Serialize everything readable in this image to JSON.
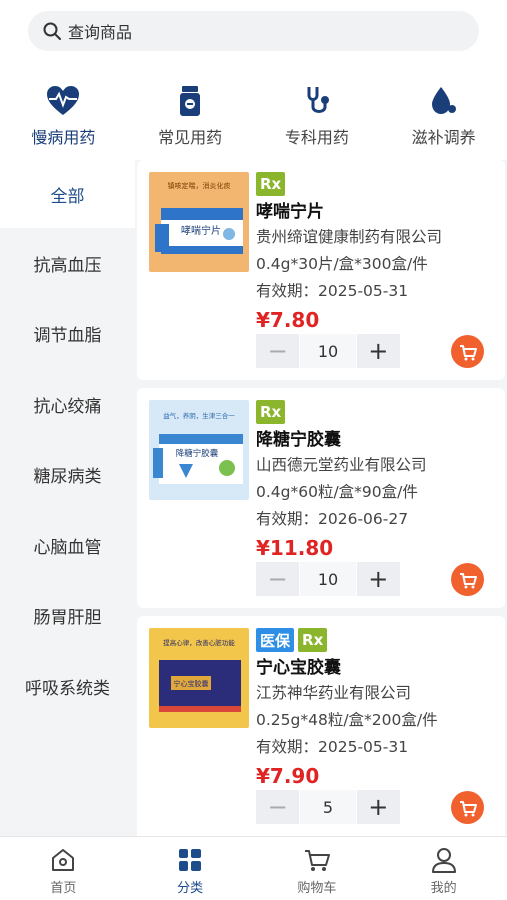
{
  "search": {
    "placeholder": "查询商品"
  },
  "top_categories": [
    {
      "label": "慢病用药",
      "icon": "heart-pulse-icon",
      "active": true
    },
    {
      "label": "常见用药",
      "icon": "pill-bottle-icon",
      "active": false
    },
    {
      "label": "专科用药",
      "icon": "stethoscope-icon",
      "active": false
    },
    {
      "label": "滋补调养",
      "icon": "drop-icon",
      "active": false
    }
  ],
  "sidebar": {
    "items": [
      {
        "label": "全部",
        "active": true
      },
      {
        "label": "抗高血压"
      },
      {
        "label": "调节血脂"
      },
      {
        "label": "抗心绞痛"
      },
      {
        "label": "糖尿病类"
      },
      {
        "label": "心脑血管"
      },
      {
        "label": "肠胃肝胆"
      },
      {
        "label": "呼吸系统类"
      }
    ]
  },
  "products": [
    {
      "tags": [
        "Rx"
      ],
      "name": "哮喘宁片",
      "maker": "贵州缔谊健康制药有限公司",
      "spec": "0.4g*30片/盒*300盒/件",
      "expiry": "有效期：2025-05-31",
      "price": "¥7.80",
      "qty": "10",
      "box_text": "哮喘宁片",
      "box_slogan": "镇咳定喘，消炎化痰"
    },
    {
      "tags": [
        "Rx"
      ],
      "name": "降糖宁胶囊",
      "maker": "山西德元堂药业有限公司",
      "spec": "0.4g*60粒/盒*90盒/件",
      "expiry": "有效期：2026-06-27",
      "price": "¥11.80",
      "qty": "10",
      "box_text": "降糖宁胶囊",
      "box_slogan": "益气，养阴，生津三合一"
    },
    {
      "tags": [
        "医保",
        "Rx"
      ],
      "name": "宁心宝胶囊",
      "maker": "江苏神华药业有限公司",
      "spec": "0.25g*48粒/盒*200盒/件",
      "expiry": "有效期：2025-05-31",
      "price": "¥7.90",
      "qty": "5",
      "box_text": "宁心宝胶囊",
      "box_slogan": "提高心律，改善心脏功能"
    }
  ],
  "stepper": {
    "minus": "−",
    "plus": "+"
  },
  "tabbar": [
    {
      "label": "首页",
      "icon": "home-icon"
    },
    {
      "label": "分类",
      "icon": "category-grid-icon",
      "active": true
    },
    {
      "label": "购物车",
      "icon": "cart-icon"
    },
    {
      "label": "我的",
      "icon": "user-icon"
    }
  ],
  "colors": {
    "accent": "#1d4b8c",
    "price": "#e02424",
    "rx_tag": "#8ab52d",
    "yb_tag": "#2f8fe6",
    "cart": "#f0612e"
  }
}
